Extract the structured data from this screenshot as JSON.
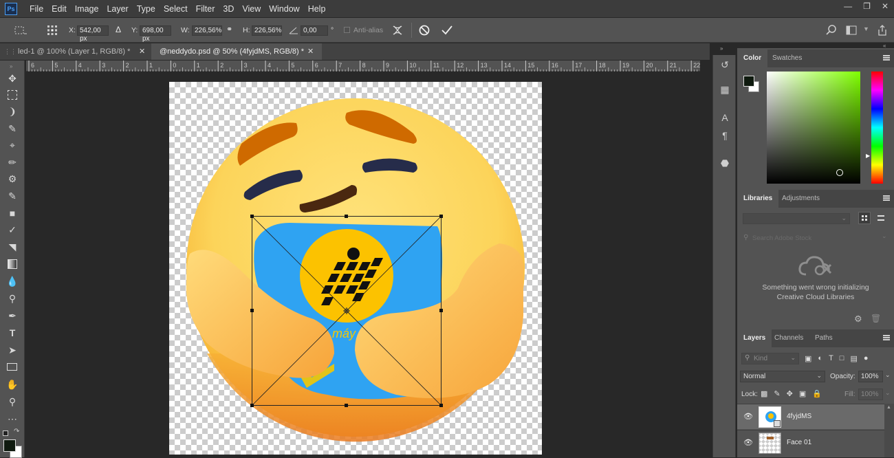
{
  "app": {
    "logo": "Ps"
  },
  "menu": [
    "File",
    "Edit",
    "Image",
    "Layer",
    "Type",
    "Select",
    "Filter",
    "3D",
    "View",
    "Window",
    "Help"
  ],
  "options": {
    "x_label": "X:",
    "x_value": "542,00 px",
    "y_label": "Y:",
    "y_value": "698,00 px",
    "w_label": "W:",
    "w_value": "226,56%",
    "h_label": "H:",
    "h_value": "226,56%",
    "angle_value": "0,00",
    "angle_unit": "°",
    "antialias_label": "Anti-alias"
  },
  "tabs": [
    {
      "label": "led-1 @ 100% (Layer 1, RGB/8) *",
      "active": false
    },
    {
      "label": "@neddydo.psd @ 50% (4fyjdMS, RGB/8) *",
      "active": true
    }
  ],
  "ruler_labels": [
    "6",
    "5",
    "4",
    "3",
    "2",
    "1",
    "0",
    "1",
    "2",
    "3",
    "4",
    "5",
    "6",
    "7",
    "8",
    "9",
    "10",
    "11",
    "12",
    "13",
    "14",
    "15",
    "16",
    "17",
    "18",
    "19",
    "20",
    "21",
    "22"
  ],
  "canvas": {
    "shirt_text": "máy"
  },
  "color_panel": {
    "tabs": [
      "Color",
      "Swatches"
    ],
    "foreground": "#0f1a0f",
    "background": "#ffffff",
    "hue": "#7fff00"
  },
  "libraries_panel": {
    "tabs": [
      "Libraries",
      "Adjustments"
    ],
    "search_placeholder": "Search Adobe Stock",
    "error_line1": "Something went wrong initializing",
    "error_line2": "Creative Cloud Libraries"
  },
  "layers_panel": {
    "tabs": [
      "Layers",
      "Channels",
      "Paths"
    ],
    "kind_label": "Kind",
    "blend_mode": "Normal",
    "opacity_label": "Opacity:",
    "opacity_value": "100%",
    "lock_label": "Lock:",
    "fill_label": "Fill:",
    "fill_value": "100%",
    "layers": [
      {
        "name": "4fyjdMS",
        "selected": true,
        "visible": true
      },
      {
        "name": "Face 01",
        "selected": false,
        "visible": true
      }
    ]
  }
}
